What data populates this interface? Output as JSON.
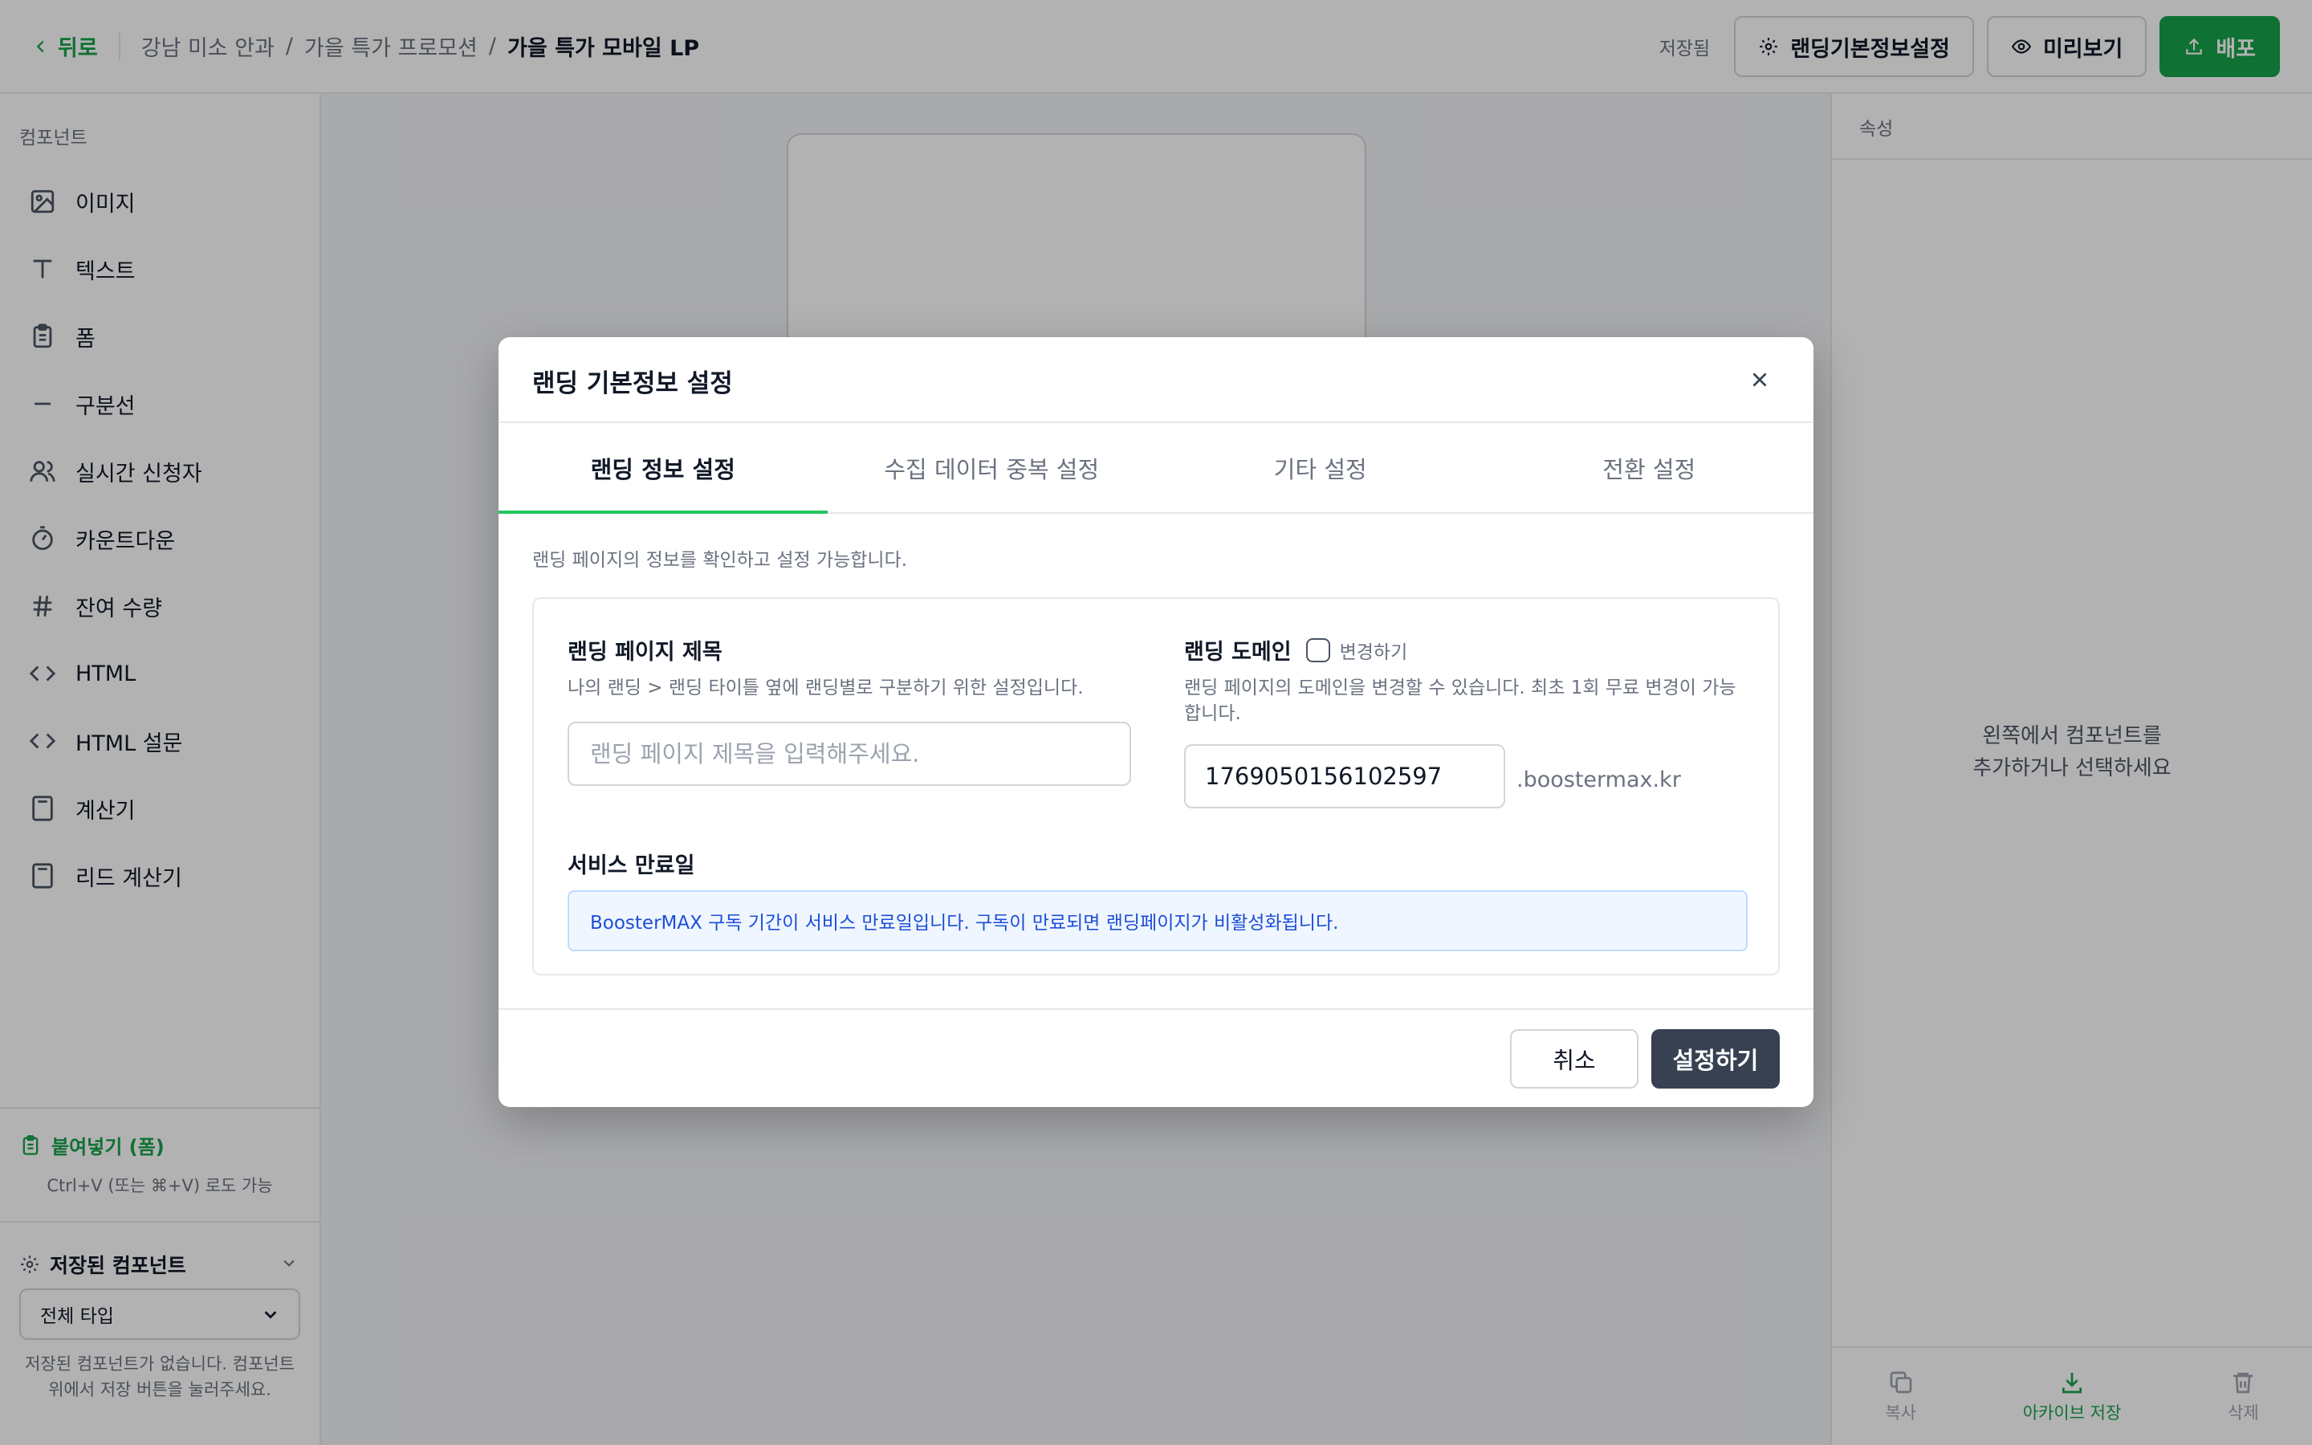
{
  "topbar": {
    "back_label": "뒤로",
    "breadcrumbs": [
      "강남 미소 안과",
      "가을 특가 프로모션",
      "가을 특가 모바일 LP"
    ],
    "separator": "/",
    "saved_status": "저장됨",
    "settings_button": "랜딩기본정보설정",
    "preview_button": "미리보기",
    "deploy_button": "배포",
    "accent_color": "#16a34a"
  },
  "sidebar": {
    "title": "컴포넌트",
    "items": [
      {
        "label": "이미지",
        "icon": "image-icon"
      },
      {
        "label": "텍스트",
        "icon": "text-icon"
      },
      {
        "label": "폼",
        "icon": "clipboard-icon"
      },
      {
        "label": "구분선",
        "icon": "divider-icon"
      },
      {
        "label": "실시간 신청자",
        "icon": "users-icon"
      },
      {
        "label": "카운트다운",
        "icon": "timer-icon"
      },
      {
        "label": "잔여 수량",
        "icon": "hash-icon"
      },
      {
        "label": "HTML",
        "icon": "code-icon"
      },
      {
        "label": "HTML 설문",
        "icon": "code-icon"
      },
      {
        "label": "계산기",
        "icon": "calculator-icon"
      },
      {
        "label": "리드 계산기",
        "icon": "calculator-icon"
      }
    ],
    "paste": {
      "title": "붙여넣기 (폼)",
      "hint": "Ctrl+V (또는 ⌘+V) 로도 가능"
    },
    "saved_components": {
      "title": "저장된 컴포넌트",
      "select_value": "전체 타입",
      "empty_text": "저장된 컴포넌트가 없습니다. 컴포넌트 위에서 저장 버튼을 눌러주세요."
    }
  },
  "right_panel": {
    "title": "속성",
    "empty_line1": "왼쪽에서 컴포넌트를",
    "empty_line2": "추가하거나 선택하세요",
    "actions": [
      "복사",
      "아카이브 저장",
      "삭제"
    ]
  },
  "modal": {
    "title": "랜딩 기본정보 설정",
    "tabs": [
      "랜딩 정보 설정",
      "수집 데이터 중복 설정",
      "기타 설정",
      "전환 설정"
    ],
    "active_tab": 0,
    "description": "랜딩 페이지의 정보를 확인하고 설정 가능합니다.",
    "page_title": {
      "label": "랜딩 페이지 제목",
      "help": "나의 랜딩 > 랜딩 타이틀 옆에 랜딩별로 구분하기 위한 설정입니다.",
      "placeholder": "랜딩 페이지 제목을 입력해주세요.",
      "value": ""
    },
    "domain": {
      "label": "랜딩 도메인",
      "checkbox_label": "변경하기",
      "checked": false,
      "help": "랜딩 페이지의 도메인을 변경할 수 있습니다. 최초 1회 무료 변경이 가능합니다.",
      "value": "1769050156102597",
      "suffix": ".boostermax.kr"
    },
    "expiry": {
      "label": "서비스 만료일",
      "notice": "BoosterMAX 구독 기간이 서비스 만료일입니다. 구독이 만료되면 랜딩페이지가 비활성화됩니다."
    },
    "cancel_button": "취소",
    "submit_button": "설정하기"
  }
}
